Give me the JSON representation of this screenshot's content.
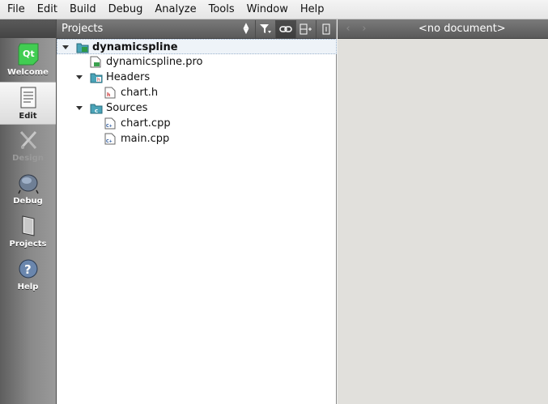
{
  "menu": [
    "File",
    "Edit",
    "Build",
    "Debug",
    "Analyze",
    "Tools",
    "Window",
    "Help"
  ],
  "modes": [
    {
      "label": "Welcome",
      "icon": "qt-logo-icon"
    },
    {
      "label": "Edit",
      "icon": "edit-document-icon"
    },
    {
      "label": "Design",
      "icon": "design-icon"
    },
    {
      "label": "Debug",
      "icon": "debug-icon"
    },
    {
      "label": "Projects",
      "icon": "projects-icon"
    },
    {
      "label": "Help",
      "icon": "help-icon"
    }
  ],
  "projects": {
    "title": "Projects",
    "tree": [
      {
        "label": "dynamicspline",
        "kind": "project-folder",
        "expanded": true,
        "bold": true,
        "selected": true
      },
      {
        "label": "dynamicspline.pro",
        "kind": "pro-file"
      },
      {
        "label": "Headers",
        "kind": "headers-folder",
        "expanded": true
      },
      {
        "label": "chart.h",
        "kind": "header-file"
      },
      {
        "label": "Sources",
        "kind": "sources-folder",
        "expanded": true
      },
      {
        "label": "chart.cpp",
        "kind": "cpp-file"
      },
      {
        "label": "main.cpp",
        "kind": "cpp-file"
      }
    ]
  },
  "editor": {
    "title": "<no document>"
  }
}
